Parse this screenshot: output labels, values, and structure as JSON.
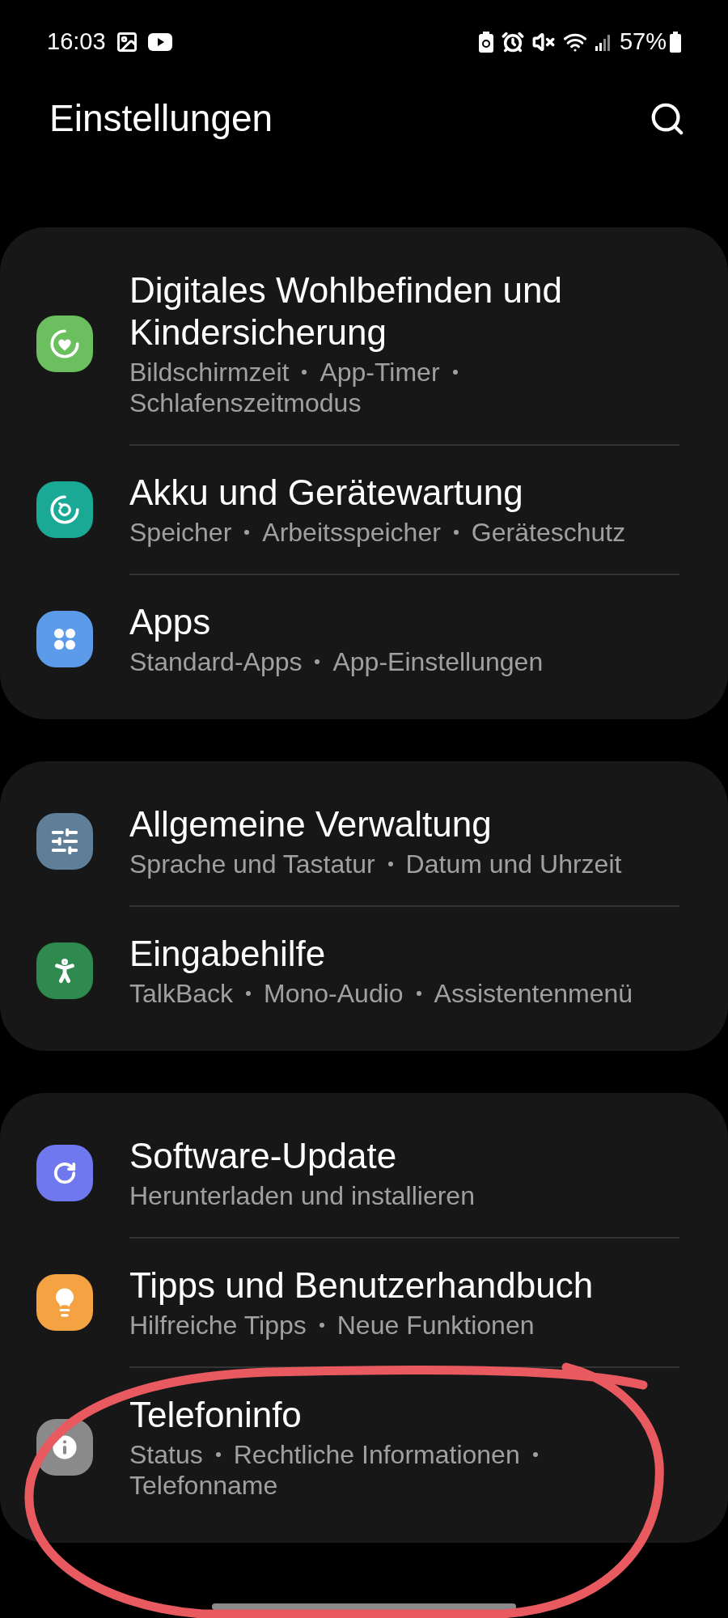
{
  "status_bar": {
    "time": "16:03",
    "battery": "57%"
  },
  "header": {
    "title": "Einstellungen"
  },
  "groups": [
    {
      "items": [
        {
          "title": "Digitales Wohlbefinden und Kindersicherung",
          "details": [
            "Bildschirmzeit",
            "App-Timer",
            "Schlafenszeitmodus"
          ],
          "color": "#6cbf5f"
        },
        {
          "title": "Akku und Gerätewartung",
          "details": [
            "Speicher",
            "Arbeitsspeicher",
            "Geräteschutz"
          ],
          "color": "#1aa995"
        },
        {
          "title": "Apps",
          "details": [
            "Standard-Apps",
            "App-Einstellungen"
          ],
          "color": "#5b9be9"
        }
      ]
    },
    {
      "items": [
        {
          "title": "Allgemeine Verwaltung",
          "details": [
            "Sprache und Tastatur",
            "Datum und Uhrzeit"
          ],
          "color": "#5f7f99"
        },
        {
          "title": "Eingabehilfe",
          "details": [
            "TalkBack",
            "Mono-Audio",
            "Assistentenmenü"
          ],
          "color": "#2e8a4e"
        }
      ]
    },
    {
      "items": [
        {
          "title": "Software-Update",
          "details": [
            "Herunterladen und installieren"
          ],
          "color": "#6f78ee"
        },
        {
          "title": "Tipps und Benutzerhandbuch",
          "details": [
            "Hilfreiche Tipps",
            "Neue Funktionen"
          ],
          "color": "#f5a242"
        },
        {
          "title": "Telefoninfo",
          "details": [
            "Status",
            "Rechtliche Informationen",
            "Telefonname"
          ],
          "color": "#8a8a8a"
        }
      ]
    }
  ]
}
